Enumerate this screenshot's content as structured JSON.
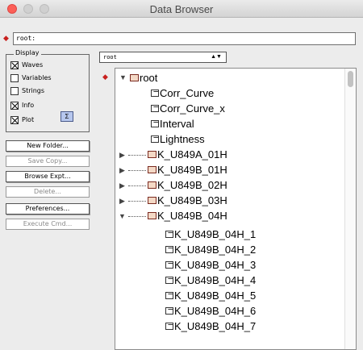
{
  "window": {
    "title": "Data Browser"
  },
  "path": {
    "value": "root:"
  },
  "display": {
    "legend": "Display",
    "options": [
      {
        "label": "Waves",
        "checked": true
      },
      {
        "label": "Variables",
        "checked": false
      },
      {
        "label": "Strings",
        "checked": false
      },
      {
        "label": "Info",
        "checked": true
      },
      {
        "label": "Plot",
        "checked": true
      }
    ],
    "sigma_label": "Σ"
  },
  "buttons": {
    "new_folder": "New Folder...",
    "save_copy": "Save Copy...",
    "browse_expt": "Browse Expt...",
    "delete": "Delete...",
    "preferences": "Preferences...",
    "execute_cmd": "Execute Cmd..."
  },
  "browse_popup": {
    "selected": "root"
  },
  "tree": {
    "root_label": "root",
    "root_waves": [
      "Corr_Curve",
      "Corr_Curve_x",
      "Interval",
      "Lightness"
    ],
    "folders": [
      "K_U849A_01H",
      "K_U849B_01H",
      "K_U849B_02H",
      "K_U849B_03H",
      "K_U849B_04H"
    ],
    "expanded_folder_waves": [
      "K_U849B_04H_1",
      "K_U849B_04H_2",
      "K_U849B_04H_3",
      "K_U849B_04H_4",
      "K_U849B_04H_5",
      "K_U849B_04H_6",
      "K_U849B_04H_7"
    ]
  },
  "colors": {
    "marker_red": "#c8201e",
    "close_button": "#fc5f57",
    "sigma_bg": "#b7c7ee"
  },
  "icons": {
    "current_marker": "red-arrow-icon",
    "folder": "folder-icon",
    "wave": "wave-icon",
    "disclosure_open": "disclosure-open-icon",
    "disclosure_closed": "disclosure-closed-icon"
  }
}
